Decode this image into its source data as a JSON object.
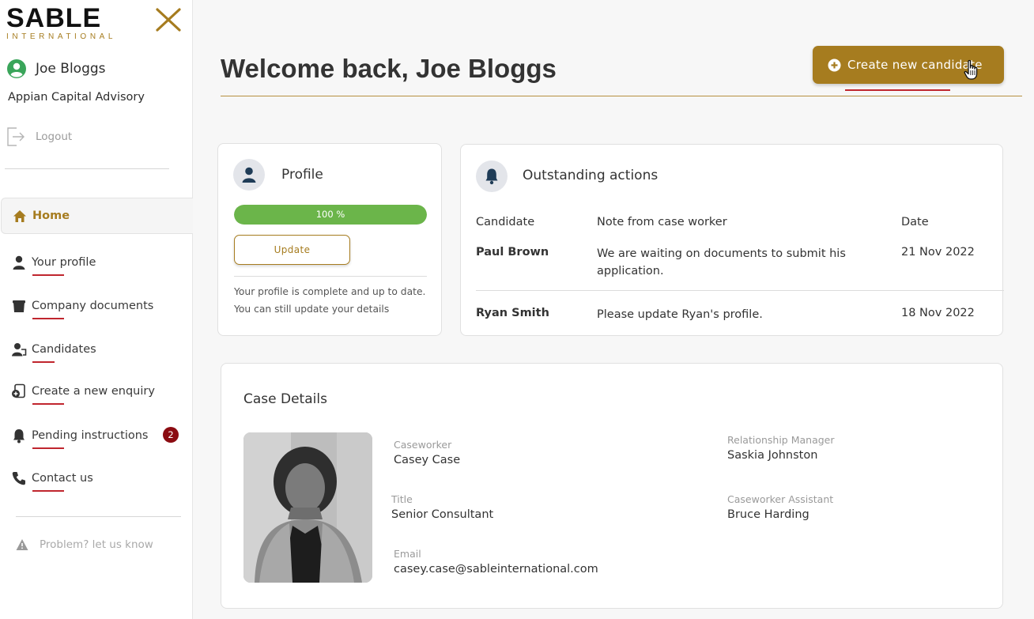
{
  "brand": {
    "name": "SABLE",
    "sub": "INTERNATIONAL",
    "accent": "#a67c1f",
    "alert": "#c0262e",
    "success": "#6bb54a"
  },
  "user": {
    "name": "Joe Bloggs",
    "company": "Appian Capital Advisory"
  },
  "logout_label": "Logout",
  "nav": {
    "home": "Home",
    "items": [
      {
        "label": "Your profile",
        "icon": "user-icon"
      },
      {
        "label": "Company documents",
        "icon": "briefcase-icon"
      },
      {
        "label": "Candidates",
        "icon": "candidates-icon"
      },
      {
        "label": "Create a new enquiry",
        "icon": "new-enquiry-icon"
      },
      {
        "label": "Pending instructions",
        "icon": "bell-icon",
        "badge": "2"
      },
      {
        "label": "Contact us",
        "icon": "phone-icon"
      }
    ]
  },
  "problem_label": "Problem? let us know",
  "header": {
    "welcome": "Welcome back, Joe Bloggs",
    "create_button": "Create new candidate"
  },
  "profile": {
    "title": "Profile",
    "progress_percent": 100,
    "progress_label": "100 %",
    "update_button": "Update",
    "note": "Your profile is complete and up to date. You can still update your details"
  },
  "actions": {
    "title": "Outstanding actions",
    "columns": [
      "Candidate",
      "Note from case worker",
      "Date"
    ],
    "rows": [
      {
        "candidate": "Paul Brown",
        "note": "We are waiting on documents to submit his application.",
        "date": "21 Nov 2022"
      },
      {
        "candidate": "Ryan Smith",
        "note": "Please update Ryan's profile.",
        "date": "18 Nov 2022"
      }
    ]
  },
  "case": {
    "title": "Case Details",
    "fields": {
      "caseworker_label": "Caseworker",
      "caseworker": "Casey Case",
      "title_label": "Title",
      "title": "Senior Consultant",
      "email_label": "Email",
      "email": "casey.case@sableinternational.com",
      "rm_label": "Relationship Manager",
      "rm": "Saskia Johnston",
      "assistant_label": "Caseworker Assistant",
      "assistant": "Bruce Harding"
    }
  }
}
